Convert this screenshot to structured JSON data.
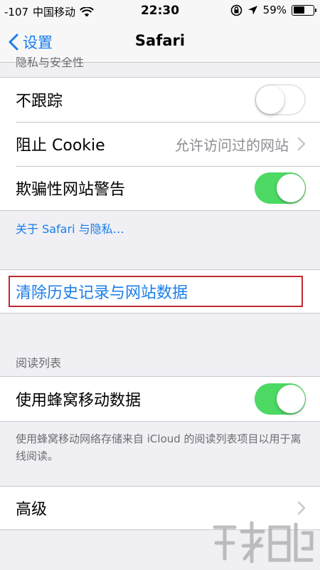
{
  "status_bar": {
    "signal": "-107",
    "carrier": "中国移动",
    "time": "22:30",
    "battery": "59%",
    "battery_level": 0.59
  },
  "nav": {
    "back_label": "设置",
    "title": "Safari"
  },
  "privacy": {
    "header": "隐私与安全性",
    "do_not_track": {
      "label": "不跟踪",
      "on": false
    },
    "block_cookies": {
      "label": "阻止 Cookie",
      "value": "允许访问过的网站"
    },
    "fraud_warning": {
      "label": "欺骗性网站警告",
      "on": true
    },
    "about_link": "关于 Safari 与隐私…"
  },
  "clear_history": {
    "label": "清除历史记录与网站数据"
  },
  "reading_list": {
    "header": "阅读列表",
    "cellular": {
      "label": "使用蜂窝移动数据",
      "on": true
    },
    "footer": "使用蜂窝移动网络存储来自 iCloud 的阅读列表项目以用于离线阅读。"
  },
  "advanced": {
    "label": "高级"
  },
  "colors": {
    "accent": "#1a7de9",
    "toggle_on": "#4cd964",
    "highlight": "#c0282f"
  }
}
